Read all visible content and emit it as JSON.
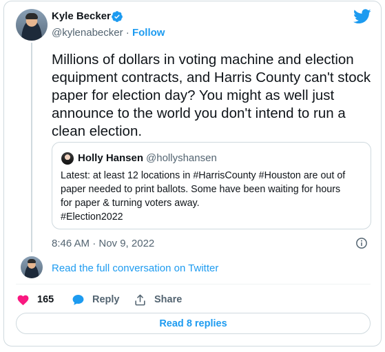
{
  "author": {
    "name": "Kyle Becker",
    "handle": "@kylenabecker",
    "separator": "·",
    "follow_label": "Follow"
  },
  "tweet": {
    "text": "Millions of dollars in voting machine and election equipment contracts, and Harris County can't stock paper for election day? You might as well just announce to the world you don't intend to run a clean election.",
    "timestamp": "8:46 AM · Nov 9, 2022"
  },
  "quoted": {
    "name": "Holly Hansen",
    "handle": "@hollyshansen",
    "line1": "Latest: at least 12 locations in #HarrisCounty #Houston are out of",
    "line2": "paper needed to print ballots. Some have been waiting for hours",
    "line3": "for paper & turning voters away.",
    "line4": "#Election2022"
  },
  "links": {
    "read_conversation": "Read the full conversation on Twitter"
  },
  "actions": {
    "like_count": "165",
    "reply_label": "Reply",
    "share_label": "Share"
  },
  "replies_button": "Read 8 replies",
  "icons": {
    "verified": "verified-badge-icon",
    "logo": "twitter-bird-icon",
    "info": "info-icon",
    "like": "heart-icon",
    "reply": "speech-bubble-icon",
    "share": "share-arrow-icon"
  },
  "colors": {
    "accent": "#1d9bf0",
    "like": "#f91880",
    "text": "#0f1419",
    "muted": "#536471",
    "border": "#cfd9de"
  }
}
